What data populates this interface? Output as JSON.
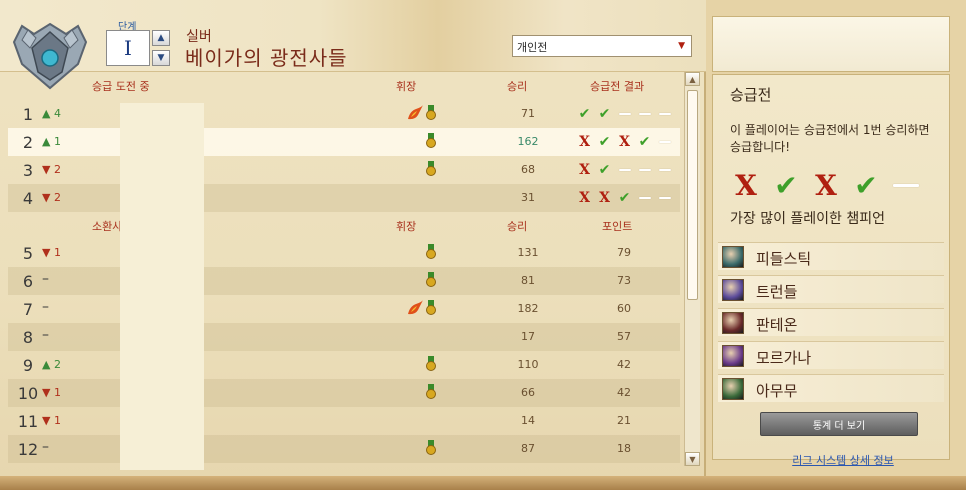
{
  "header": {
    "division_label": "단계",
    "division_value": "I",
    "tier_name": "실버",
    "league_name": "베이가의 광전사들",
    "queue": "개인전"
  },
  "promo_section": {
    "columns": {
      "name": "승급 도전 중",
      "badges": "휘장",
      "wins": "승리",
      "series": "승급전 결과"
    },
    "rows": [
      {
        "rank": "1",
        "delta": "4",
        "trend": "up",
        "badges": [
          "fire",
          "medal"
        ],
        "wins": "71",
        "series": [
          "win",
          "win",
          "pending",
          "pending",
          "pending"
        ]
      },
      {
        "rank": "2",
        "delta": "1",
        "trend": "up",
        "badges": [
          "medal"
        ],
        "wins": "162",
        "series": [
          "loss",
          "win",
          "loss",
          "win",
          "pending"
        ]
      },
      {
        "rank": "3",
        "delta": "2",
        "trend": "down",
        "badges": [
          "medal"
        ],
        "wins": "68",
        "series": [
          "loss",
          "win",
          "pending",
          "pending",
          "pending"
        ]
      },
      {
        "rank": "4",
        "delta": "2",
        "trend": "down",
        "badges": [],
        "wins": "31",
        "series": [
          "loss",
          "loss",
          "win",
          "pending",
          "pending"
        ]
      }
    ]
  },
  "ladder_section": {
    "columns": {
      "name": "소환사",
      "badges": "휘장",
      "wins": "승리",
      "points": "포인트"
    },
    "rows": [
      {
        "rank": "5",
        "delta": "1",
        "trend": "down",
        "badges": [
          "medal"
        ],
        "wins": "131",
        "points": "79"
      },
      {
        "rank": "6",
        "delta": "–",
        "trend": "none",
        "badges": [
          "medal"
        ],
        "wins": "81",
        "points": "73"
      },
      {
        "rank": "7",
        "delta": "–",
        "trend": "none",
        "badges": [
          "fire",
          "medal"
        ],
        "wins": "182",
        "points": "60"
      },
      {
        "rank": "8",
        "delta": "–",
        "trend": "none",
        "badges": [],
        "wins": "17",
        "points": "57"
      },
      {
        "rank": "9",
        "delta": "2",
        "trend": "up",
        "badges": [
          "medal"
        ],
        "wins": "110",
        "points": "42"
      },
      {
        "rank": "10",
        "delta": "1",
        "trend": "down",
        "badges": [
          "medal"
        ],
        "wins": "66",
        "points": "42"
      },
      {
        "rank": "11",
        "delta": "1",
        "trend": "down",
        "badges": [],
        "wins": "14",
        "points": "21"
      },
      {
        "rank": "12",
        "delta": "–",
        "trend": "none",
        "badges": [
          "medal"
        ],
        "wins": "87",
        "points": "18"
      }
    ]
  },
  "side_panel": {
    "title": "승급전",
    "description": "이 플레이어는 승급전에서 1번 승리하면 승급합니다!",
    "series": [
      "loss",
      "win",
      "loss",
      "win",
      "pending"
    ],
    "champions_title": "가장 많이 플레이한 챔피언",
    "champions": [
      {
        "name": "피들스틱",
        "color": "#3a6a6a"
      },
      {
        "name": "트런들",
        "color": "#5a4a9a"
      },
      {
        "name": "판테온",
        "color": "#6a2a2a"
      },
      {
        "name": "모르가나",
        "color": "#6a3a8a"
      },
      {
        "name": "아무무",
        "color": "#3a6a3a"
      }
    ],
    "stats_button": "통계 더 보기",
    "info_link": "리그 시스템 상세 정보"
  }
}
